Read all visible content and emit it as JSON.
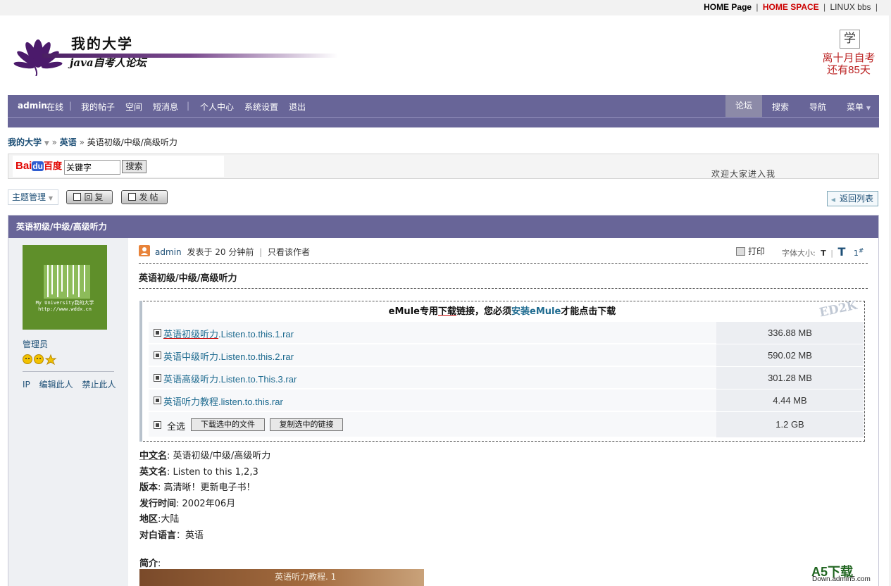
{
  "topbar": {
    "home_page": "HOME Page",
    "home_space": "HOME SPACE",
    "linux_bbs": "LINUX bbs",
    "sep": "|"
  },
  "banner": {
    "title": "我的大学",
    "subtitle": "java自考人论坛"
  },
  "countdown": {
    "glyph": "学",
    "line1": "离十月自考",
    "line2": "还有85天"
  },
  "nav": {
    "user": "admin",
    "status": "在线",
    "items": [
      "我的帖子",
      "空间",
      "短消息",
      "个人中心",
      "系统设置",
      "退出"
    ],
    "right": [
      "论坛",
      "搜索",
      "导航",
      "菜单"
    ]
  },
  "breadcrumb": {
    "home": "我的大学",
    "section": "英语",
    "current": "英语初级/中级/高级听力"
  },
  "search": {
    "logo_bai": "Bai",
    "logo_du": "du",
    "logo_cn": "百度",
    "value": "关键字",
    "button": "搜索",
    "marquee": "欢迎大家进入我"
  },
  "actions": {
    "topic_manage": "主题管理",
    "reply": "回复",
    "post": "发帖",
    "back_to_list": "返回列表"
  },
  "thread": {
    "header": "英语初级/中级/高级听力",
    "author_role": "管理员",
    "left_links": [
      "IP",
      "编辑此人",
      "禁止此人"
    ],
    "avatar_text1": "My University我的大学",
    "avatar_text2": "http://www.wddx.cn",
    "meta_author": "admin",
    "meta_posted": "发表于 20 分钟前",
    "meta_sep": "|",
    "meta_only": "只看该作者",
    "print": "打印",
    "font_size_label": "字体大小:",
    "font_small": "T",
    "font_large": "T",
    "floor": "1",
    "floor_sup": "#",
    "title": "英语初级/中级/高级听力"
  },
  "ed2k": {
    "head_pre": "eMule专用",
    "head_ul": "下载",
    "head_mid": "链接，您必须",
    "head_link": "安装eMule",
    "head_post": "才能点击下载",
    "watermark": "ED2K",
    "files": [
      {
        "cn": "英语初级听力",
        "en": ".Listen.to.this.1.rar",
        "size": "336.88 MB"
      },
      {
        "cn": "英语中级听力",
        "en": ".Listen.to.this.2.rar",
        "size": "590.02 MB"
      },
      {
        "cn": "英语高级听力",
        "en": ".Listen.to.This.3.rar",
        "size": "301.28 MB"
      },
      {
        "cn": "英语听力教程",
        "en": ".listen.to.this.rar",
        "size": "4.44 MB"
      }
    ],
    "select_all": "全选",
    "download_btn": "下载选中的文件",
    "copy_btn": "复制选中的链接",
    "total": "1.2 GB"
  },
  "info": {
    "cn_label": "中文名",
    "cn_value": ": 英语初级/中级/高级听力",
    "en_label": "英文名",
    "en_value": ": Listen to this 1,2,3",
    "ver_label": "版本",
    "ver_value": ": 高清晰！更新电子书！",
    "date_label": "发行时间",
    "date_value": ": 2002年06月",
    "region_label": "地区",
    "region_value": ":大陆",
    "lang_label": "对白语言",
    "lang_value": "：英语",
    "intro_label": "简介",
    "intro_colon": ":",
    "cover_text": "英语听力教程. 1"
  },
  "watermark": {
    "a5": "A5下载",
    "a5_sub": "Down.admin5.com"
  },
  "colors": {
    "nav": "#686598",
    "link": "#1d4f76",
    "accent_red": "#cc0000"
  }
}
